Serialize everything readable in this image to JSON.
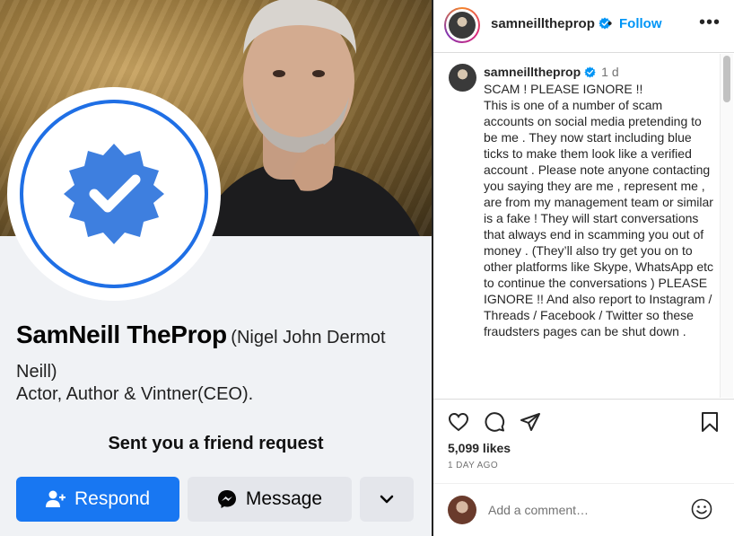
{
  "facebook_profile": {
    "name": "SamNeill TheProp",
    "alt_name": "(Nigel John Dermot Neill)",
    "tagline": "Actor, Author & Vintner(CEO).",
    "friend_request_text": "Sent you a friend request",
    "respond_label": "Respond",
    "message_label": "Message",
    "more_icon": "chevron-down-icon",
    "badge_color": "#1f6fe5"
  },
  "instagram_post": {
    "username": "samneilltheprop",
    "separator": "•",
    "follow_label": "Follow",
    "more_icon": "more-horizontal-icon",
    "caption_username": "samneilltheprop",
    "caption_time": "1 d",
    "caption_text": "SCAM ! PLEASE IGNORE !!\nThis is one of a number of scam accounts on social media pretending to be me . They now start including blue ticks to make them look like a verified account . Please note anyone contacting you saying they are me , represent me , are from my management team or similar is a fake ! They will start conversations that always end in scamming you out of money . (They’ll also try get you on to other platforms like Skype, WhatsApp etc to continue the conversations ) PLEASE IGNORE !! And also report to Instagram / Threads / Facebook / Twitter so these fraudsters pages can be shut down .",
    "likes": "5,099 likes",
    "time_ago": "1 DAY AGO",
    "comment_placeholder": "Add a comment…",
    "accent_color": "#0095f6"
  }
}
